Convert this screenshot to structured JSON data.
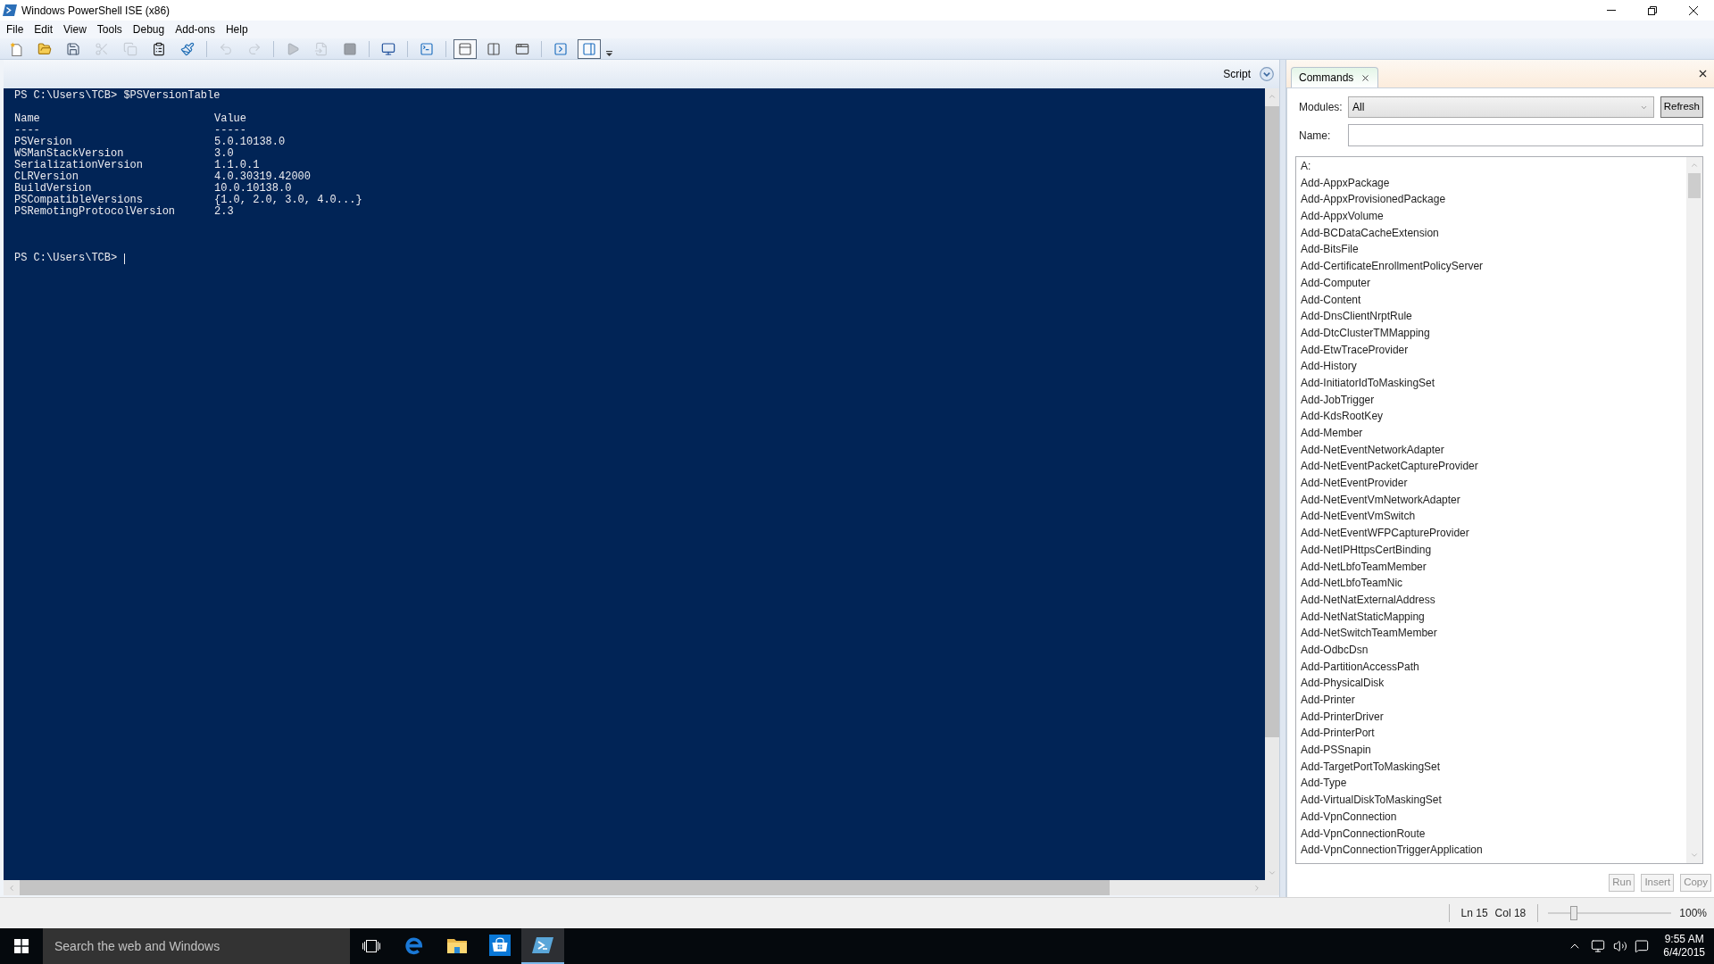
{
  "window": {
    "title": "Windows PowerShell ISE (x86)"
  },
  "menu": [
    "File",
    "Edit",
    "View",
    "Tools",
    "Debug",
    "Add-ons",
    "Help"
  ],
  "toolbar": [
    {
      "kind": "actions",
      "items": [
        {
          "disabled": false
        },
        {
          "disabled": false
        },
        {
          "disabled": false
        },
        {
          "disabled": true
        },
        {
          "disabled": true
        },
        {
          "disabled": false
        },
        {
          "disabled": false
        }
      ]
    },
    {
      "kind": "actions",
      "items": [
        {
          "disabled": true
        },
        {
          "disabled": true
        }
      ]
    },
    {
      "kind": "actions",
      "items": [
        {
          "disabled": true
        },
        {
          "disabled": true
        },
        {
          "disabled": true
        }
      ]
    },
    {
      "kind": "actions",
      "items": [
        {
          "disabled": false
        }
      ]
    },
    {
      "kind": "actions",
      "items": [
        {
          "disabled": false
        }
      ]
    },
    {
      "kind": "toggles",
      "items": [
        {
          "selected": true
        },
        {
          "selected": false
        },
        {
          "selected": false
        }
      ]
    },
    {
      "kind": "toggles",
      "items": [
        {
          "selected": false
        },
        {
          "selected": true
        }
      ]
    }
  ],
  "console": {
    "pane_button": "Script",
    "command": "PS C:\\Users\\TCB> $PSVersionTable",
    "table": {
      "headers": [
        "Name",
        "Value"
      ],
      "underlines": [
        "----",
        "-----"
      ],
      "rows": [
        {
          "name": "PSVersion",
          "value": "5.0.10138.0"
        },
        {
          "name": "WSManStackVersion",
          "value": "3.0"
        },
        {
          "name": "SerializationVersion",
          "value": "1.1.0.1"
        },
        {
          "name": "CLRVersion",
          "value": "4.0.30319.42000"
        },
        {
          "name": "BuildVersion",
          "value": "10.0.10138.0"
        },
        {
          "name": "PSCompatibleVersions",
          "value": "{1.0, 2.0, 3.0, 4.0...}"
        },
        {
          "name": "PSRemotingProtocolVersion",
          "value": "2.3"
        }
      ]
    },
    "prompt": "PS C:\\Users\\TCB>"
  },
  "commands": {
    "tab": {
      "label": "Commands",
      "selected": true
    },
    "modules": {
      "label": "Modules:",
      "value": "All"
    },
    "refresh": "Refresh",
    "name": {
      "label": "Name:"
    },
    "items": [
      "A:",
      "Add-AppxPackage",
      "Add-AppxProvisionedPackage",
      "Add-AppxVolume",
      "Add-BCDataCacheExtension",
      "Add-BitsFile",
      "Add-CertificateEnrollmentPolicyServer",
      "Add-Computer",
      "Add-Content",
      "Add-DnsClientNrptRule",
      "Add-DtcClusterTMMapping",
      "Add-EtwTraceProvider",
      "Add-History",
      "Add-InitiatorIdToMaskingSet",
      "Add-JobTrigger",
      "Add-KdsRootKey",
      "Add-Member",
      "Add-NetEventNetworkAdapter",
      "Add-NetEventPacketCaptureProvider",
      "Add-NetEventProvider",
      "Add-NetEventVmNetworkAdapter",
      "Add-NetEventVmSwitch",
      "Add-NetEventWFPCaptureProvider",
      "Add-NetIPHttpsCertBinding",
      "Add-NetLbfoTeamMember",
      "Add-NetLbfoTeamNic",
      "Add-NetNatExternalAddress",
      "Add-NetNatStaticMapping",
      "Add-NetSwitchTeamMember",
      "Add-OdbcDsn",
      "Add-PartitionAccessPath",
      "Add-PhysicalDisk",
      "Add-Printer",
      "Add-PrinterDriver",
      "Add-PrinterPort",
      "Add-PSSnapin",
      "Add-TargetPortToMaskingSet",
      "Add-Type",
      "Add-VirtualDiskToMaskingSet",
      "Add-VpnConnection",
      "Add-VpnConnectionRoute",
      "Add-VpnConnectionTriggerApplication"
    ],
    "buttons": [
      {
        "label": "Run",
        "disabled": true
      },
      {
        "label": "Insert",
        "disabled": true
      },
      {
        "label": "Copy",
        "disabled": true
      }
    ]
  },
  "status_bar": {
    "line": "Ln 15",
    "column": "Col 18",
    "zoom": {
      "level": 0.21,
      "reading": "100%"
    }
  },
  "taskbar": {
    "search": {
      "placeholder": "Search the web and Windows"
    },
    "apps": [
      {
        "selected": false
      },
      {
        "selected": false
      },
      {
        "selected": false
      },
      {
        "selected": true
      }
    ],
    "clock": {
      "time": "9:55 AM",
      "date": "6/4/2015"
    }
  }
}
